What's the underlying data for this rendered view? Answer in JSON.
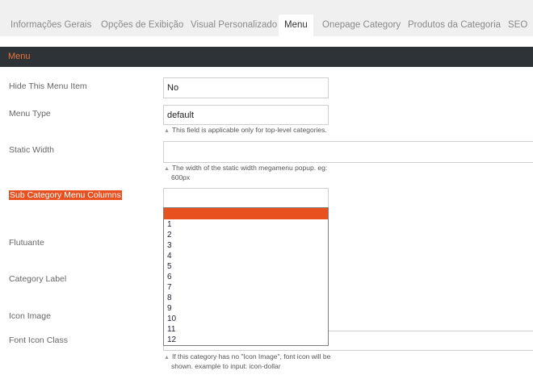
{
  "tabs": [
    {
      "label": "Informações Gerais",
      "active": false
    },
    {
      "label": "Opções de Exibição",
      "active": false
    },
    {
      "label": "Visual Personalizado",
      "active": false
    },
    {
      "label": "Menu",
      "active": true
    },
    {
      "label": "Onepage Category",
      "active": false
    },
    {
      "label": "Produtos da Categoria",
      "active": false
    },
    {
      "label": "SEO",
      "active": false
    }
  ],
  "section": {
    "title": "Menu"
  },
  "form": {
    "hide_menu_item": {
      "label": "Hide This Menu Item",
      "value": "No"
    },
    "menu_type": {
      "label": "Menu Type",
      "value": "default",
      "note": "This field is applicable only for top-level categories."
    },
    "static_width": {
      "label": "Static Width",
      "value": "",
      "note_line1": "The width of the static width megamenu popup. eg:",
      "note_line2": "600px"
    },
    "sub_category_columns": {
      "label": "Sub Category Menu Columns",
      "value": ""
    },
    "flutuante": {
      "label": "Flutuante"
    },
    "category_label": {
      "label": "Category Label"
    },
    "icon_image": {
      "label": "Icon Image"
    },
    "font_icon_class": {
      "label": "Font Icon Class",
      "note_line1": "If this category has no \"Icon Image\", font icon will be",
      "note_line2": "shown. example to input: icon-dollar"
    }
  },
  "dropdown_options": [
    "",
    "1",
    "2",
    "3",
    "4",
    "5",
    "6",
    "7",
    "8",
    "9",
    "10",
    "11",
    "12"
  ],
  "colors": {
    "accent": "#e8501f",
    "header_bg": "#2e3338",
    "header_text": "#e8743b",
    "tabbar_bg": "#f0f0f0"
  }
}
